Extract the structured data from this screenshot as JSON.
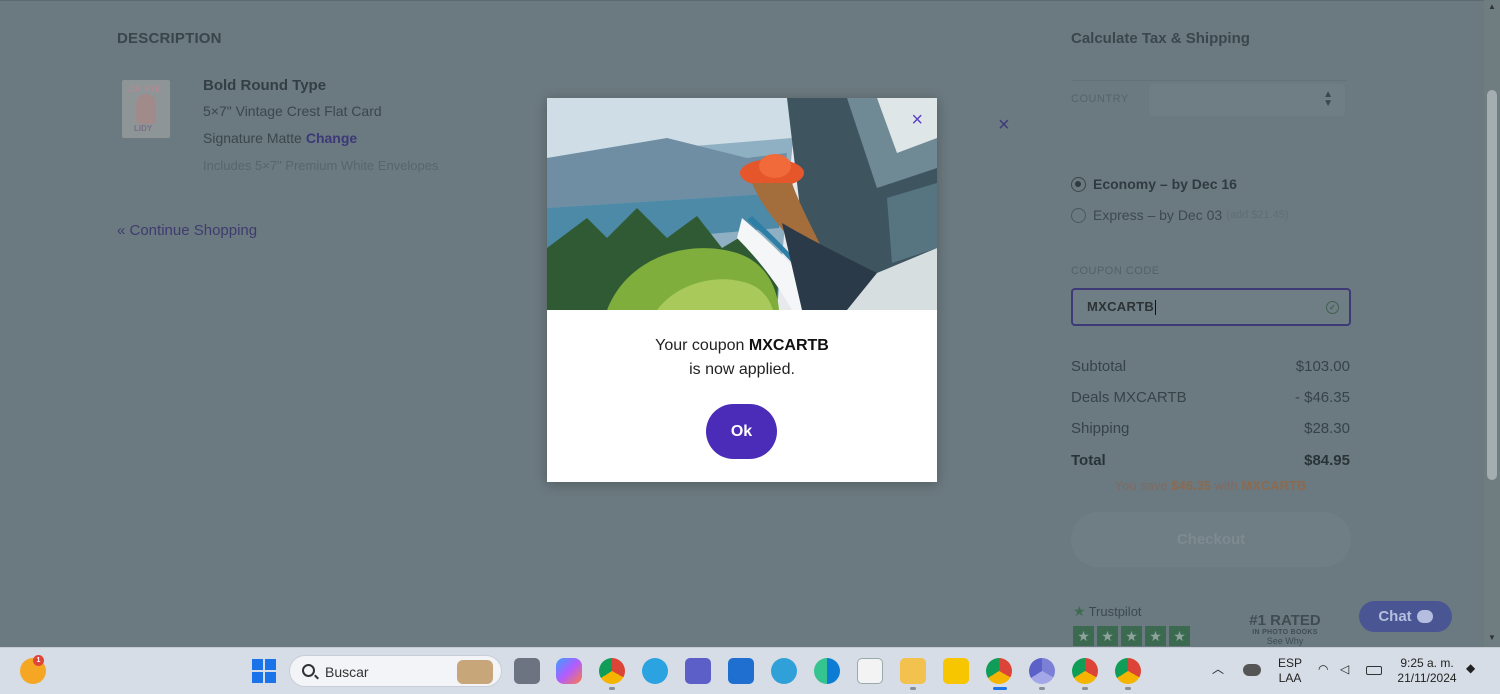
{
  "page": {
    "description_heading": "DESCRIPTION",
    "product": {
      "name": "Bold Round Type",
      "format": "5×7\" Vintage Crest Flat Card",
      "paper": "Signature Matte",
      "change_label": "Change",
      "envelopes": "Includes 5×7\" Premium White Envelopes",
      "thumb_text_top": "JA PIE",
      "thumb_text_bottom": "LIDY"
    },
    "remove_icon": "×",
    "continue_shopping": "« Continue Shopping"
  },
  "sidebar": {
    "title": "Calculate Tax & Shipping",
    "country_label": "COUNTRY",
    "country_value": "",
    "shipping_options": [
      {
        "label": "Economy – by Dec 16",
        "selected": true,
        "note": ""
      },
      {
        "label": "Express – by Dec 03",
        "selected": false,
        "note": "(add $21.45)"
      }
    ],
    "coupon_label": "COUPON CODE",
    "coupon_value": "MXCARTB",
    "summary": [
      {
        "label": "Subtotal",
        "value": "$103.00"
      },
      {
        "label": "Deals MXCARTB",
        "value": "- $46.35"
      },
      {
        "label": "Shipping",
        "value": "$28.30"
      }
    ],
    "total_label": "Total",
    "total_value": "$84.95",
    "save_prefix": "You save",
    "save_amount": "$46.35",
    "save_mid": "with",
    "save_code": "MXCARTB",
    "checkout_label": "Checkout",
    "trustpilot_label": "Trustpilot",
    "rated_big": "#1 RATED",
    "rated_small": "IN PHOTO BOOKS",
    "rated_see": "See Why",
    "chat_label": "Chat"
  },
  "modal": {
    "close_icon": "×",
    "message_prefix": "Your coupon",
    "coupon_code": "MXCARTB",
    "message_line2": "is now applied.",
    "ok_label": "Ok"
  },
  "taskbar": {
    "search_placeholder": "Buscar",
    "lang_top": "ESP",
    "lang_bottom": "LAA",
    "time": "9:25 a. m.",
    "date": "21/11/2024",
    "weather_badge": "1"
  },
  "colors": {
    "accent": "#4a2cb8",
    "overlay_bg": "#6b7a80",
    "taskbar_bg": "#d7dde6"
  }
}
